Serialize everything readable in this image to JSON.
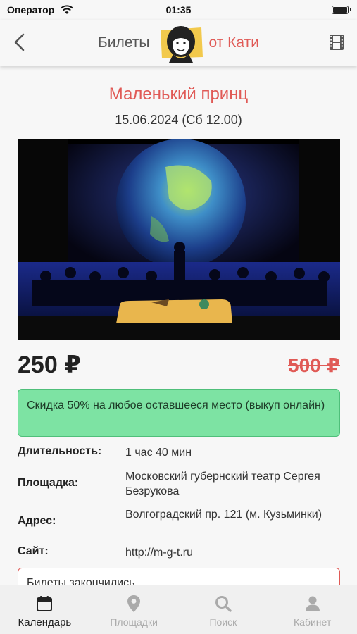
{
  "status": {
    "carrier": "Оператор",
    "time": "01:35"
  },
  "header": {
    "brand_left": "Билеты",
    "brand_right": "от Кати"
  },
  "event": {
    "title": "Маленький принц",
    "date": "15.06.2024 (Сб 12.00)",
    "price": "250 ₽",
    "old_price": "500 ₽",
    "discount": "Скидка 50% на любое оставшееся место (выкуп онлайн)",
    "details": [
      {
        "label": "Длительность:",
        "value": "1 час 40 мин"
      },
      {
        "label": "Площадка:",
        "value": "Московский губернский театр Сергея Безрукова"
      },
      {
        "label": "Адрес:",
        "value": "Волгоградский пр. 121 (м. Кузьминки)"
      },
      {
        "label": "Сайт:",
        "value": "http://m-g-t.ru"
      }
    ],
    "sold_out": "Билеты закончились"
  },
  "tabs": [
    {
      "label": "Календарь",
      "icon": "calendar-icon",
      "active": true
    },
    {
      "label": "Площадки",
      "icon": "location-pin-icon",
      "active": false
    },
    {
      "label": "Поиск",
      "icon": "search-icon",
      "active": false
    },
    {
      "label": "Кабинет",
      "icon": "user-icon",
      "active": false
    }
  ],
  "colors": {
    "accent": "#e05a56",
    "discount_bg": "#7de3a3",
    "tab_inactive": "#aaaaaa"
  }
}
